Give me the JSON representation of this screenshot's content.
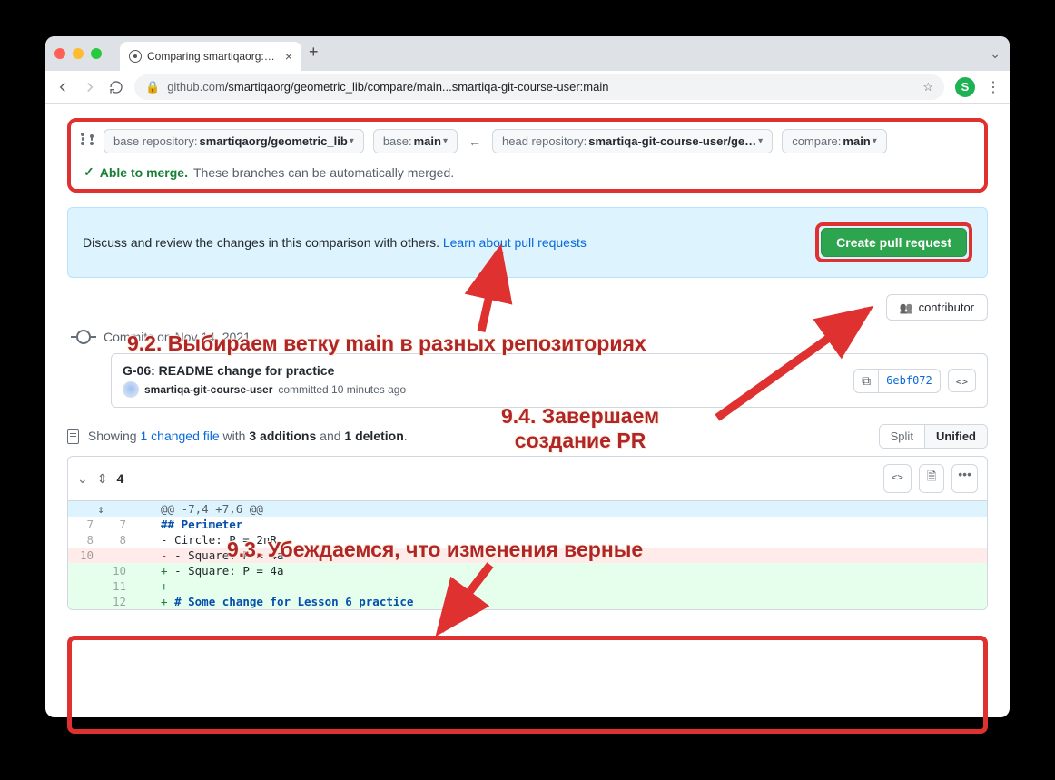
{
  "browser": {
    "tab_title": "Comparing smartiqaorg:main...",
    "url_host": "github.com",
    "url_path": "/smartiqaorg/geometric_lib/compare/main...smartiqa-git-course-user:main",
    "profile_letter": "S"
  },
  "compare": {
    "base_repo_label": "base repository:",
    "base_repo_value": "smartiqaorg/geometric_lib",
    "base_label": "base:",
    "base_value": "main",
    "head_repo_label": "head repository:",
    "head_repo_value": "smartiqa-git-course-user/ge…",
    "compare_label": "compare:",
    "compare_value": "main",
    "able_label": "Able to merge.",
    "able_detail": "These branches can be automatically merged."
  },
  "action": {
    "text": "Discuss and review the changes in this comparison with others. ",
    "link": "Learn about pull requests",
    "button": "Create pull request"
  },
  "contributor": {
    "label": "contributor"
  },
  "timeline": {
    "date": "Commits on Nov 14, 2021",
    "commit_title": "G-06: README change for practice",
    "commit_author": "smartiqa-git-course-user",
    "commit_when": "committed 10 minutes ago",
    "sha": "6ebf072"
  },
  "files": {
    "showing": "Showing ",
    "changed": "1 changed file",
    "mid": " with ",
    "additions": "3 additions",
    "and": " and ",
    "deletions": "1 deletion",
    "period": ".",
    "split": "Split",
    "unified": "Unified"
  },
  "diff": {
    "file_header_changes": "4",
    "hunk": "@@ -7,4 +7,6 @@",
    "expand_icon": "↕",
    "lines": {
      "l7": "## Perimeter",
      "l8": "- Circle: P = 2πR",
      "l10d": "- Square: P = 4a",
      "l10a": "- Square: P = 4a",
      "l12": "# Some change for Lesson 6 practice"
    }
  },
  "annotations": {
    "a92": "9.2. Выбираем ветку main в разных репозиториях",
    "a93": "9.3. Убеждаемся, что изменения верные",
    "a94_l1": "9.4. Завершаем",
    "a94_l2": "создание PR"
  }
}
